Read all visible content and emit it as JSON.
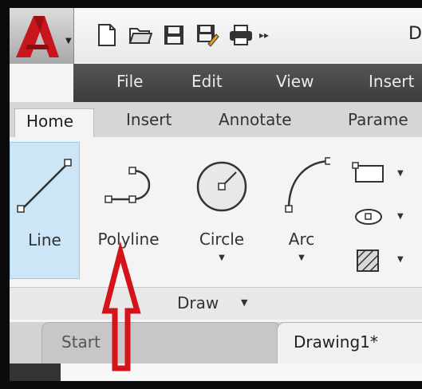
{
  "title_bar": {
    "doc_title_partial": "D",
    "qat_more_label": "▸▸"
  },
  "menu_bar": {
    "items": [
      "File",
      "Edit",
      "View",
      "Insert"
    ]
  },
  "ribbon_tabs": {
    "active": "Home",
    "others": [
      "Insert",
      "Annotate",
      "Parame"
    ]
  },
  "draw_panel": {
    "tools": [
      {
        "label": "Line"
      },
      {
        "label": "Polyline"
      },
      {
        "label": "Circle"
      },
      {
        "label": "Arc"
      }
    ],
    "footer_label": "Draw"
  },
  "file_tabs": {
    "start": "Start",
    "drawing": "Drawing1*"
  },
  "colors": {
    "annotation_arrow": "#d4141a",
    "app_logo": "#c8161d",
    "menubar": "#444444",
    "active_tool_bg": "#cde6f7"
  }
}
